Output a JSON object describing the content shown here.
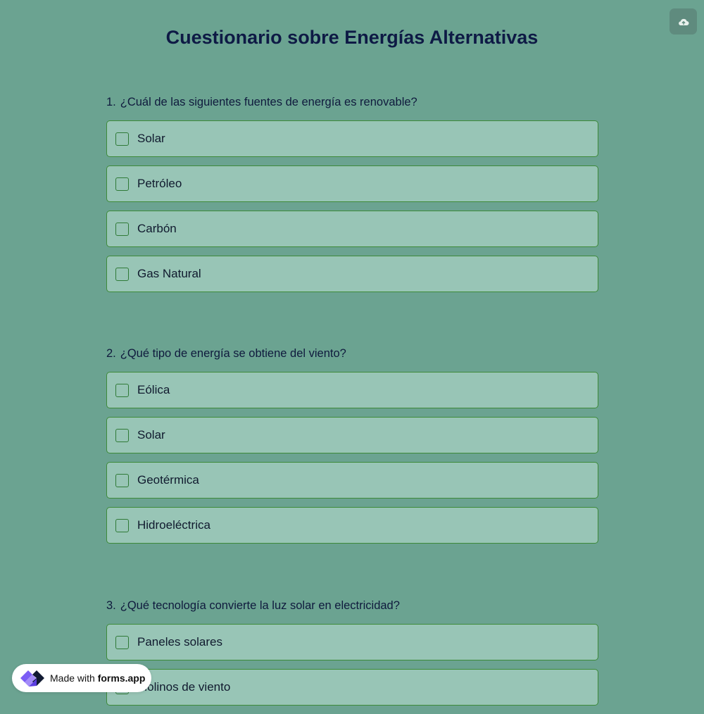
{
  "title": "Cuestionario sobre Energías Alternativas",
  "save_button": {
    "icon": "cloud-upload-icon"
  },
  "questions": [
    {
      "number": "1.",
      "text": "¿Cuál de las siguientes fuentes de energía es renovable?",
      "options": [
        "Solar",
        "Petróleo",
        "Carbón",
        "Gas Natural"
      ]
    },
    {
      "number": "2.",
      "text": "¿Qué tipo de energía se obtiene del viento?",
      "options": [
        "Eólica",
        "Solar",
        "Geotérmica",
        "Hidroeléctrica"
      ]
    },
    {
      "number": "3.",
      "text": "¿Qué tecnología convierte la luz solar en electricidad?",
      "options": [
        "Paneles solares",
        "Molinos de viento"
      ]
    }
  ],
  "badge": {
    "prefix": "Made with",
    "brand": "forms.app",
    "icon": "forms-app-logo-icon"
  },
  "colors": {
    "background": "#6ba391",
    "option_fill": "#98c5b6",
    "option_border": "#3d8a39",
    "title": "#0e1a45",
    "save_button": "#5f8b7e",
    "logo_purple": "#7b5cf5"
  }
}
